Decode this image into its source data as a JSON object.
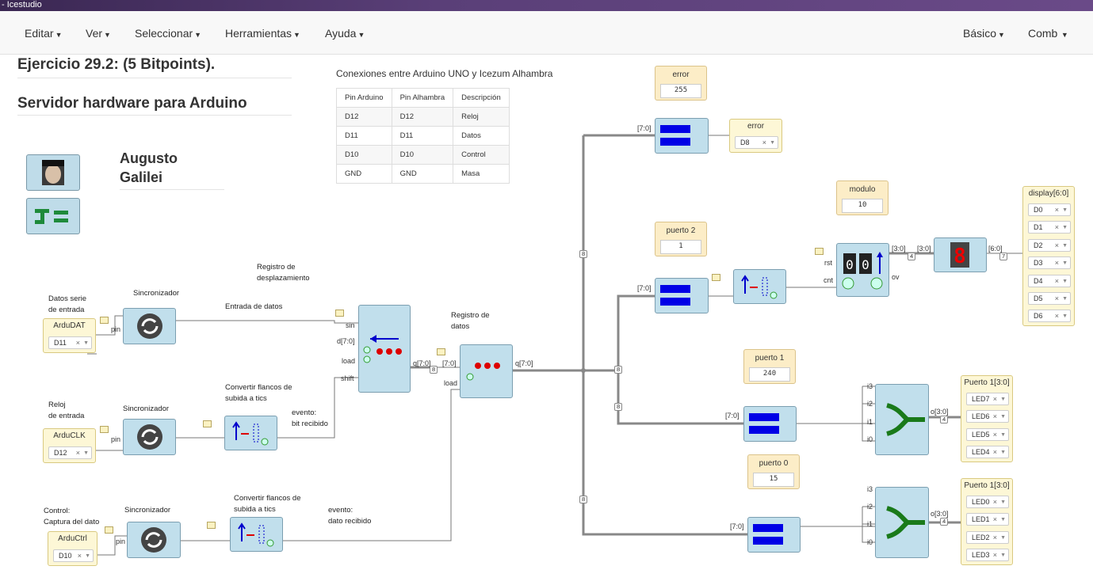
{
  "window": {
    "title": "- Icestudio"
  },
  "menu": {
    "items": [
      "Editar",
      "Ver",
      "Seleccionar",
      "Herramientas",
      "Ayuda"
    ],
    "right": [
      "Básico",
      "Comb"
    ]
  },
  "doc": {
    "title": "Ejercicio 29.2: (5 Bitpoints).",
    "subtitle": "Servidor hardware para Arduino",
    "author_first": "Augusto",
    "author_last": "Galilei"
  },
  "table": {
    "caption": "Conexiones entre Arduino UNO y Icezum Alhambra",
    "headers": [
      "Pin Arduino",
      "Pin Alhambra",
      "Descripción"
    ],
    "rows": [
      [
        "D12",
        "D12",
        "Reloj"
      ],
      [
        "D11",
        "D11",
        "Datos"
      ],
      [
        "D10",
        "D10",
        "Control"
      ],
      [
        "GND",
        "GND",
        "Masa"
      ]
    ]
  },
  "inputs": [
    {
      "label1": "Datos serie",
      "label2": "de entrada",
      "name": "ArduDAT",
      "pin": "D11"
    },
    {
      "label1": "Reloj",
      "label2": "de entrada",
      "name": "ArduCLK",
      "pin": "D12"
    },
    {
      "label1": "Control:",
      "label2": "Captura del dato",
      "name": "ArduCtrl",
      "pin": "D10"
    }
  ],
  "labels": {
    "sync": "Sincronizador",
    "shift_reg1": "Registro de",
    "shift_reg2": "desplazamiento",
    "data_in": "Entrada de datos",
    "conv1": "Convertir flancos de",
    "conv2": "subida a tics",
    "ev_bit1": "evento:",
    "ev_bit2": "bit recibido",
    "ev_dato1": "evento:",
    "ev_dato2": "dato recibido",
    "data_reg1": "Registro de",
    "data_reg2": "datos"
  },
  "ports": {
    "pin": "pin",
    "sin": "sin",
    "d70": "d[7:0]",
    "load": "load",
    "shift": "shift",
    "q70": "q[7:0]",
    "b70": "[7:0]",
    "rst": "rst",
    "cnt": "cnt",
    "ov": "ov",
    "b30": "[3:0]",
    "b60": "[6:0]",
    "i3": "i3",
    "i2": "i2",
    "i1": "i1",
    "i0": "i0",
    "o30": "o[3:0]",
    "w8": "8",
    "w4": "4",
    "w7": "7"
  },
  "constants": [
    {
      "name": "error",
      "value": "255"
    },
    {
      "name": "puerto 2",
      "value": "1"
    },
    {
      "name": "modulo",
      "value": "10"
    },
    {
      "name": "puerto 1",
      "value": "240"
    },
    {
      "name": "puerto 0",
      "value": "15"
    }
  ],
  "outputs": {
    "error": {
      "name": "error",
      "pins": [
        "D8"
      ]
    },
    "display": {
      "name": "display[6:0]",
      "pins": [
        "D0",
        "D1",
        "D2",
        "D3",
        "D4",
        "D5",
        "D6"
      ]
    },
    "port1": {
      "name": "Puerto 1[3:0]",
      "pins": [
        "LED7",
        "LED6",
        "LED5",
        "LED4"
      ]
    },
    "port0": {
      "name": "Puerto 1[3:0]",
      "pins": [
        "LED0",
        "LED1",
        "LED2",
        "LED3"
      ]
    }
  },
  "colors": {
    "block": "#c1dfec",
    "pin": "#fdf7d6",
    "const": "#fcedc7",
    "wire": "#777777",
    "bus": "#888888",
    "accent": "#0000e6"
  }
}
